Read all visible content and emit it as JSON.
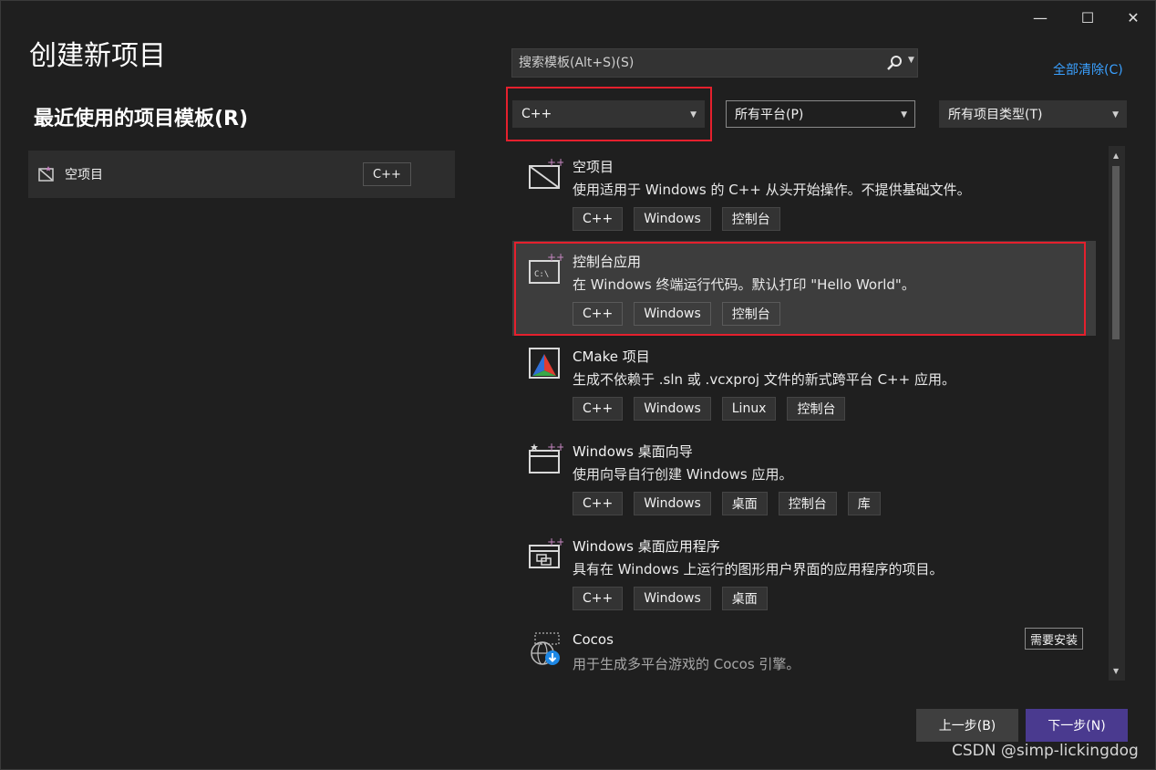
{
  "window": {
    "minimize_glyph": "—",
    "maximize_glyph": "☐",
    "close_glyph": "✕"
  },
  "page_title": "创建新项目",
  "recent": {
    "title": "最近使用的项目模板(R)",
    "items": [
      {
        "label": "空项目",
        "tag": "C++",
        "icon": "empty-project-icon"
      }
    ]
  },
  "search": {
    "placeholder": "搜索模板(Alt+S)(S)",
    "value": ""
  },
  "clear_all": "全部清除(C)",
  "filters": {
    "language": "C++",
    "platform": "所有平台(P)",
    "project_type": "所有项目类型(T)"
  },
  "templates": [
    {
      "name": "空项目",
      "desc": "使用适用于 Windows 的 C++ 从头开始操作。不提供基础文件。",
      "tags": [
        "C++",
        "Windows",
        "控制台"
      ],
      "icon": "empty-project-icon"
    },
    {
      "name": "控制台应用",
      "desc": "在 Windows 终端运行代码。默认打印 \"Hello World\"。",
      "tags": [
        "C++",
        "Windows",
        "控制台"
      ],
      "icon": "console-app-icon",
      "selected": true
    },
    {
      "name": "CMake 项目",
      "desc": "生成不依赖于 .sln 或 .vcxproj 文件的新式跨平台 C++ 应用。",
      "tags": [
        "C++",
        "Windows",
        "Linux",
        "控制台"
      ],
      "icon": "cmake-icon"
    },
    {
      "name": "Windows 桌面向导",
      "desc": "使用向导自行创建 Windows 应用。",
      "tags": [
        "C++",
        "Windows",
        "桌面",
        "控制台",
        "库"
      ],
      "icon": "desktop-wizard-icon"
    },
    {
      "name": "Windows 桌面应用程序",
      "desc": "具有在 Windows 上运行的图形用户界面的应用程序的项目。",
      "tags": [
        "C++",
        "Windows",
        "桌面"
      ],
      "icon": "desktop-app-icon"
    },
    {
      "name": "Cocos",
      "desc": "用于生成多平台游戏的 Cocos 引擎。",
      "tags": [],
      "icon": "cocos-globe-icon",
      "badge": "需要安装"
    }
  ],
  "buttons": {
    "back": "上一步(B)",
    "next": "下一步(N)"
  },
  "watermark": "CSDN @simp-lickingdog",
  "colors": {
    "background": "#1f1f1f",
    "accent_link": "#3aa0ff",
    "next_button": "#4a3a8f",
    "highlight_frame": "#e5202d"
  }
}
